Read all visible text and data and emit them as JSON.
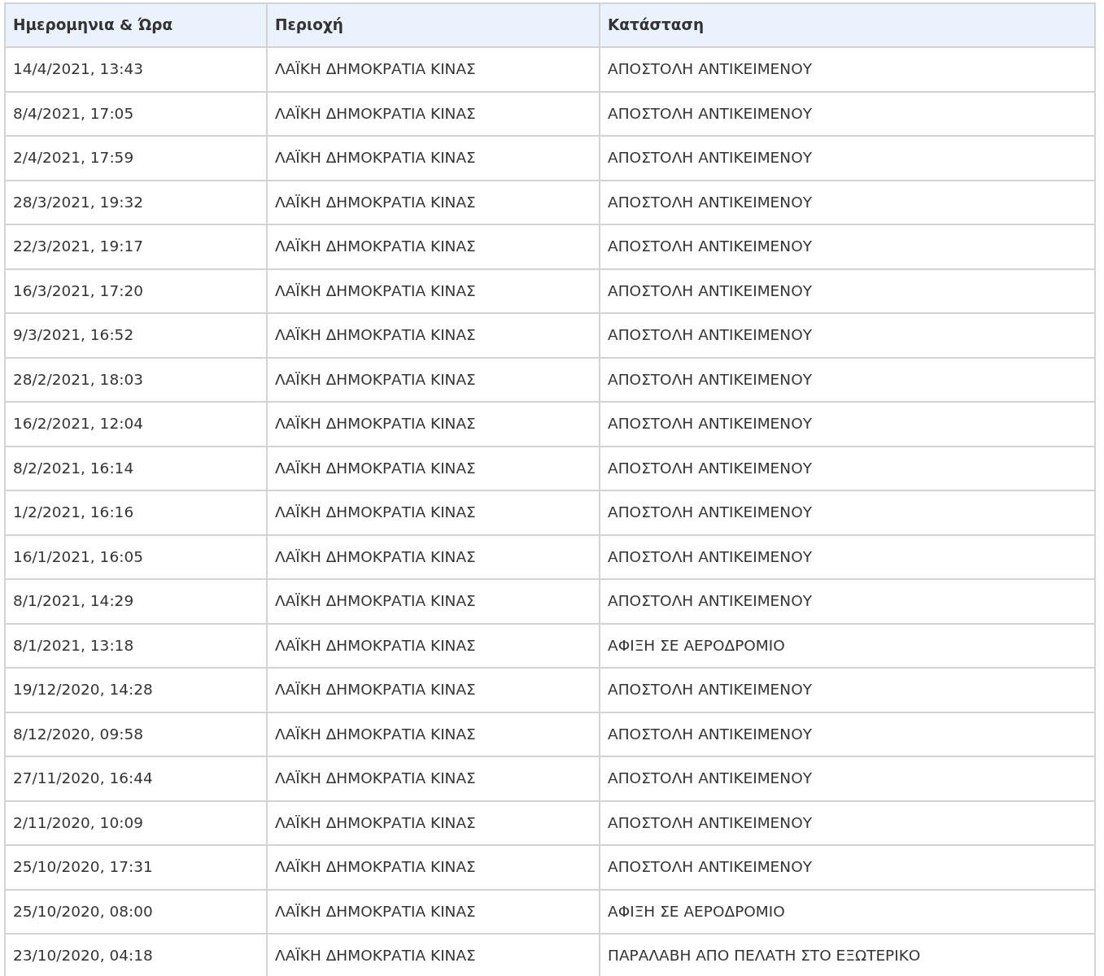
{
  "table": {
    "columns": [
      "Ημερομηνια & Ώρα",
      "Περιοχή",
      "Κατάσταση"
    ],
    "rows": [
      [
        "14/4/2021, 13:43",
        "ΛΑΪΚΗ ΔΗΜΟΚΡΑΤΙΑ ΚΙΝΑΣ",
        "ΑΠΟΣΤΟΛΗ ΑΝΤΙΚΕΙΜΕΝΟΥ"
      ],
      [
        "8/4/2021, 17:05",
        "ΛΑΪΚΗ ΔΗΜΟΚΡΑΤΙΑ ΚΙΝΑΣ",
        "ΑΠΟΣΤΟΛΗ ΑΝΤΙΚΕΙΜΕΝΟΥ"
      ],
      [
        "2/4/2021, 17:59",
        "ΛΑΪΚΗ ΔΗΜΟΚΡΑΤΙΑ ΚΙΝΑΣ",
        "ΑΠΟΣΤΟΛΗ ΑΝΤΙΚΕΙΜΕΝΟΥ"
      ],
      [
        "28/3/2021, 19:32",
        "ΛΑΪΚΗ ΔΗΜΟΚΡΑΤΙΑ ΚΙΝΑΣ",
        "ΑΠΟΣΤΟΛΗ ΑΝΤΙΚΕΙΜΕΝΟΥ"
      ],
      [
        "22/3/2021, 19:17",
        "ΛΑΪΚΗ ΔΗΜΟΚΡΑΤΙΑ ΚΙΝΑΣ",
        "ΑΠΟΣΤΟΛΗ ΑΝΤΙΚΕΙΜΕΝΟΥ"
      ],
      [
        "16/3/2021, 17:20",
        "ΛΑΪΚΗ ΔΗΜΟΚΡΑΤΙΑ ΚΙΝΑΣ",
        "ΑΠΟΣΤΟΛΗ ΑΝΤΙΚΕΙΜΕΝΟΥ"
      ],
      [
        "9/3/2021, 16:52",
        "ΛΑΪΚΗ ΔΗΜΟΚΡΑΤΙΑ ΚΙΝΑΣ",
        "ΑΠΟΣΤΟΛΗ ΑΝΤΙΚΕΙΜΕΝΟΥ"
      ],
      [
        "28/2/2021, 18:03",
        "ΛΑΪΚΗ ΔΗΜΟΚΡΑΤΙΑ ΚΙΝΑΣ",
        "ΑΠΟΣΤΟΛΗ ΑΝΤΙΚΕΙΜΕΝΟΥ"
      ],
      [
        "16/2/2021, 12:04",
        "ΛΑΪΚΗ ΔΗΜΟΚΡΑΤΙΑ ΚΙΝΑΣ",
        "ΑΠΟΣΤΟΛΗ ΑΝΤΙΚΕΙΜΕΝΟΥ"
      ],
      [
        "8/2/2021, 16:14",
        "ΛΑΪΚΗ ΔΗΜΟΚΡΑΤΙΑ ΚΙΝΑΣ",
        "ΑΠΟΣΤΟΛΗ ΑΝΤΙΚΕΙΜΕΝΟΥ"
      ],
      [
        "1/2/2021, 16:16",
        "ΛΑΪΚΗ ΔΗΜΟΚΡΑΤΙΑ ΚΙΝΑΣ",
        "ΑΠΟΣΤΟΛΗ ΑΝΤΙΚΕΙΜΕΝΟΥ"
      ],
      [
        "16/1/2021, 16:05",
        "ΛΑΪΚΗ ΔΗΜΟΚΡΑΤΙΑ ΚΙΝΑΣ",
        "ΑΠΟΣΤΟΛΗ ΑΝΤΙΚΕΙΜΕΝΟΥ"
      ],
      [
        "8/1/2021, 14:29",
        "ΛΑΪΚΗ ΔΗΜΟΚΡΑΤΙΑ ΚΙΝΑΣ",
        "ΑΠΟΣΤΟΛΗ ΑΝΤΙΚΕΙΜΕΝΟΥ"
      ],
      [
        "8/1/2021, 13:18",
        "ΛΑΪΚΗ ΔΗΜΟΚΡΑΤΙΑ ΚΙΝΑΣ",
        "ΑΦΙΞΗ ΣΕ ΑΕΡΟΔΡΟΜΙΟ"
      ],
      [
        "19/12/2020, 14:28",
        "ΛΑΪΚΗ ΔΗΜΟΚΡΑΤΙΑ ΚΙΝΑΣ",
        "ΑΠΟΣΤΟΛΗ ΑΝΤΙΚΕΙΜΕΝΟΥ"
      ],
      [
        "8/12/2020, 09:58",
        "ΛΑΪΚΗ ΔΗΜΟΚΡΑΤΙΑ ΚΙΝΑΣ",
        "ΑΠΟΣΤΟΛΗ ΑΝΤΙΚΕΙΜΕΝΟΥ"
      ],
      [
        "27/11/2020, 16:44",
        "ΛΑΪΚΗ ΔΗΜΟΚΡΑΤΙΑ ΚΙΝΑΣ",
        "ΑΠΟΣΤΟΛΗ ΑΝΤΙΚΕΙΜΕΝΟΥ"
      ],
      [
        "2/11/2020, 10:09",
        "ΛΑΪΚΗ ΔΗΜΟΚΡΑΤΙΑ ΚΙΝΑΣ",
        "ΑΠΟΣΤΟΛΗ ΑΝΤΙΚΕΙΜΕΝΟΥ"
      ],
      [
        "25/10/2020, 17:31",
        "ΛΑΪΚΗ ΔΗΜΟΚΡΑΤΙΑ ΚΙΝΑΣ",
        "ΑΠΟΣΤΟΛΗ ΑΝΤΙΚΕΙΜΕΝΟΥ"
      ],
      [
        "25/10/2020, 08:00",
        "ΛΑΪΚΗ ΔΗΜΟΚΡΑΤΙΑ ΚΙΝΑΣ",
        "ΑΦΙΞΗ ΣΕ ΑΕΡΟΔΡΟΜΙΟ"
      ],
      [
        "23/10/2020, 04:18",
        "ΛΑΪΚΗ ΔΗΜΟΚΡΑΤΙΑ ΚΙΝΑΣ",
        "ΠΑΡΑΛΑΒΗ ΑΠΟ ΠΕΛΑΤΗ ΣΤΟ ΕΞΩΤΕΡΙΚΟ"
      ]
    ]
  }
}
